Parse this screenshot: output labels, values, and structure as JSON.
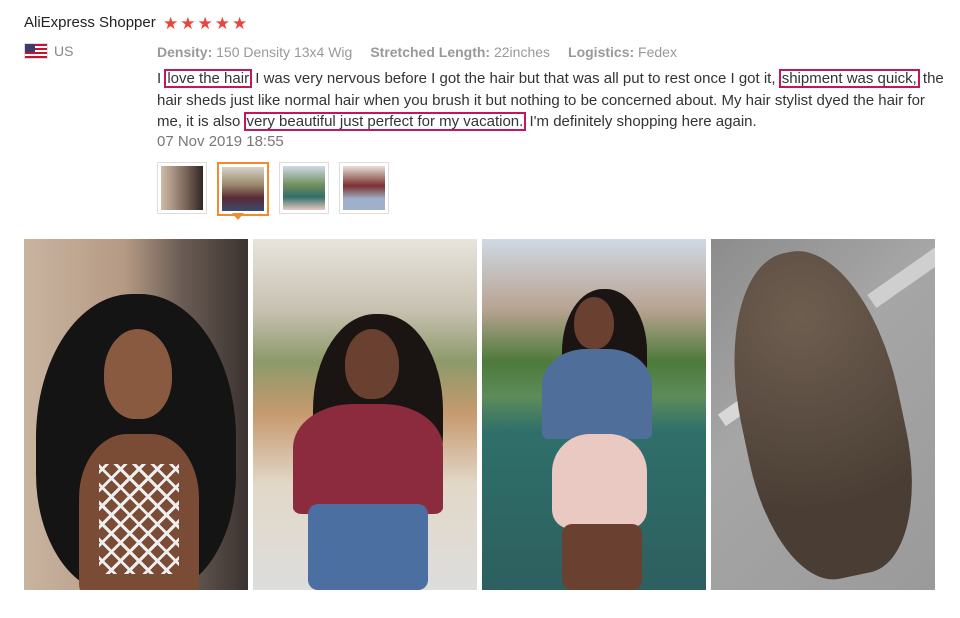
{
  "reviewer": {
    "name": "AliExpress Shopper",
    "stars": [
      "★",
      "★",
      "★",
      "★",
      "★"
    ]
  },
  "country": {
    "code": "US",
    "flag_icon": "us-flag-icon"
  },
  "attributes": [
    {
      "label": "Density:",
      "value": "150 Density 13x4 Wig"
    },
    {
      "label": "Stretched Length:",
      "value": "22inches"
    },
    {
      "label": "Logistics:",
      "value": "Fedex"
    }
  ],
  "review": {
    "p1": "I ",
    "h1": "love the hair",
    "p2": " I was very nervous before I got the hair but that was all put to rest once I got it, ",
    "h2": "shipment was quick,",
    "p3": " the hair sheds just like normal hair when you brush it but nothing to be concerned about. My hair stylist dyed the hair for me, it is also ",
    "h3": "very beautiful just perfect for my vacation.",
    "p4": " I'm definitely shopping here again."
  },
  "date": "07 Nov 2019 18:55",
  "thumbnails": {
    "count": 4,
    "selected_index": 1
  },
  "colors": {
    "star": "#e8453c",
    "highlight": "#c2185b",
    "selected_thumb": "#f08c2c"
  }
}
